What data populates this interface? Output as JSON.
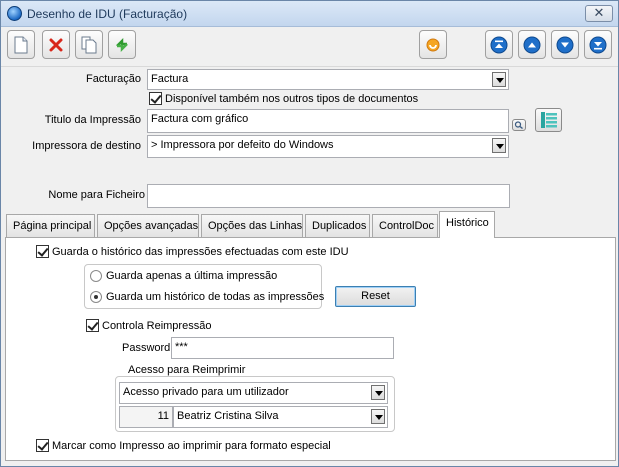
{
  "window": {
    "title": "Desenho de IDU (Facturação)",
    "close_glyph": "✕"
  },
  "toolbar": {
    "buttons": [
      "new-document-icon",
      "delete-icon",
      "copy-icon",
      "refresh-icon",
      "wizard-icon",
      "first-record-icon",
      "previous-record-icon",
      "next-record-icon",
      "last-record-icon"
    ]
  },
  "form": {
    "facturacao_label": "Facturação",
    "facturacao_value": "Factura",
    "disponivel_label": "Disponível também nos outros tipos de documentos",
    "disponivel_checked": true,
    "titulo_label": "Titulo da Impressão",
    "titulo_value": "Factura com gráfico",
    "impressora_label": "Impressora de destino",
    "impressora_value": "> Impressora por defeito do Windows",
    "nome_label": "Nome para Ficheiro",
    "nome_value": ""
  },
  "tabs": [
    {
      "label": "Página principal",
      "active": false
    },
    {
      "label": "Opções avançadas",
      "active": false
    },
    {
      "label": "Opções das Linhas",
      "active": false
    },
    {
      "label": "Duplicados",
      "active": false
    },
    {
      "label": "ControlDoc",
      "active": false
    },
    {
      "label": "Histórico",
      "active": true
    }
  ],
  "historico": {
    "guarda_historico_label": "Guarda o histórico das impressões efectuadas com este IDU",
    "guarda_historico_checked": true,
    "radio_ultima_label": "Guarda apenas a última impressão",
    "radio_todas_label": "Guarda um histórico de todas as impressões",
    "radio_selected": "todas",
    "reset_label": "Reset",
    "controla_label": "Controla Reimpressão",
    "controla_checked": true,
    "password_label": "Password",
    "password_value": "***",
    "acesso_label": "Acesso para Reimprimir",
    "acesso_value": "Acesso privado para um utilizador",
    "user_id": "11",
    "user_name": "Beatriz Cristina Silva",
    "marcar_label": "Marcar como Impresso ao imprimir para formato especial",
    "marcar_checked": true
  },
  "colors": {
    "titlebar": "#c3d6ee",
    "nav_blue": "#1f6fc9",
    "delete_red": "#d8281c",
    "wizard_orange": "#f08a1c"
  }
}
